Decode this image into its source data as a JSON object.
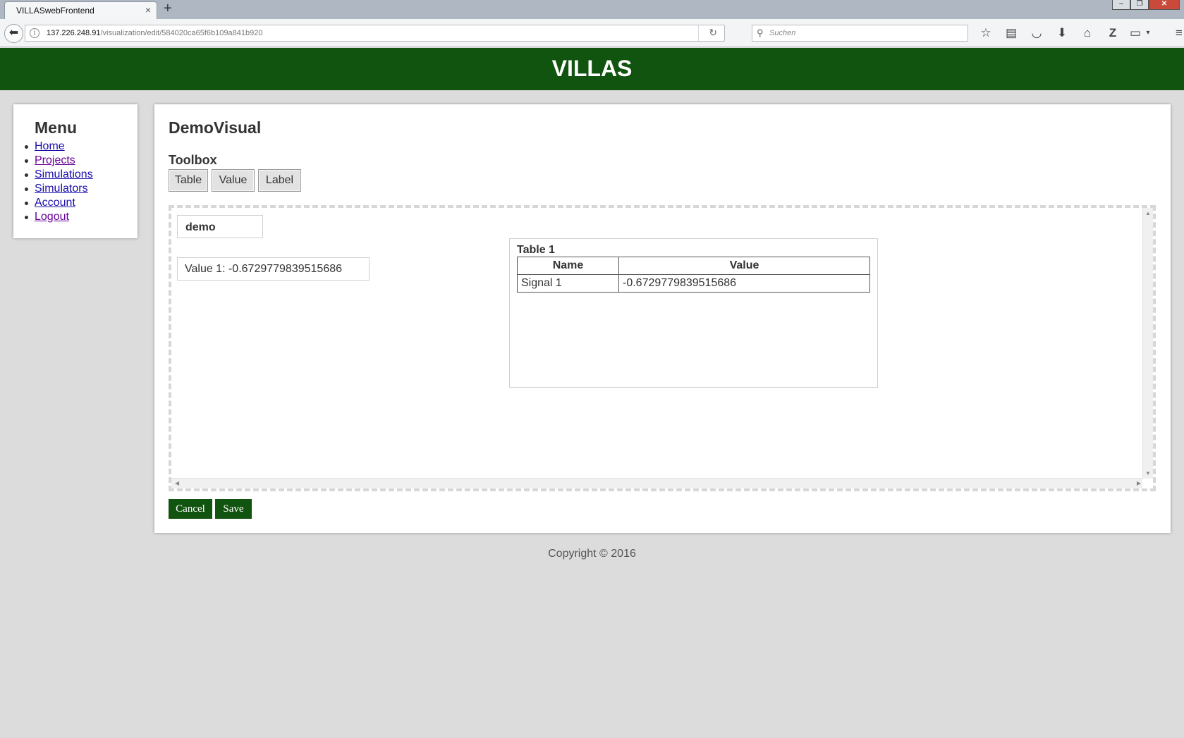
{
  "browser": {
    "tab_title": "VILLASwebFrontend",
    "tab_close": "×",
    "new_tab": "+",
    "window_controls": {
      "minimize": "–",
      "maximize": "❐",
      "close": "✕"
    },
    "url_host": "137.226.248.91",
    "url_path": "/visualization/edit/584020ca65f6b109a841b920",
    "search_placeholder": "Suchen",
    "icons": [
      "star-icon",
      "reading-list-icon",
      "pocket-icon",
      "download-icon",
      "home-icon",
      "zotero-icon",
      "page-icon",
      "dropdown-icon",
      "hamburger-menu-icon"
    ]
  },
  "header": {
    "title": "VILLAS"
  },
  "menu": {
    "title": "Menu",
    "items": [
      {
        "label": "Home",
        "visited": false
      },
      {
        "label": "Projects",
        "visited": true
      },
      {
        "label": "Simulations",
        "visited": false
      },
      {
        "label": "Simulators",
        "visited": false
      },
      {
        "label": "Account",
        "visited": false
      },
      {
        "label": "Logout",
        "visited": true
      }
    ]
  },
  "visualization": {
    "title": "DemoVisual",
    "toolbox": {
      "title": "Toolbox",
      "buttons": [
        "Table",
        "Value",
        "Label"
      ]
    },
    "widgets": {
      "label": {
        "text": "demo"
      },
      "value": {
        "text": "Value 1: -0.6729779839515686"
      },
      "table": {
        "title": "Table 1",
        "columns": [
          "Name",
          "Value"
        ],
        "rows": [
          [
            "Signal 1",
            "-0.6729779839515686"
          ]
        ]
      }
    },
    "actions": {
      "cancel": "Cancel",
      "save": "Save"
    }
  },
  "footer": {
    "copyright": "Copyright © 2016"
  },
  "colors": {
    "brand_green": "#10540f",
    "page_background": "#dcdcdc",
    "link": "#1a0dab",
    "link_visited": "#660099"
  }
}
